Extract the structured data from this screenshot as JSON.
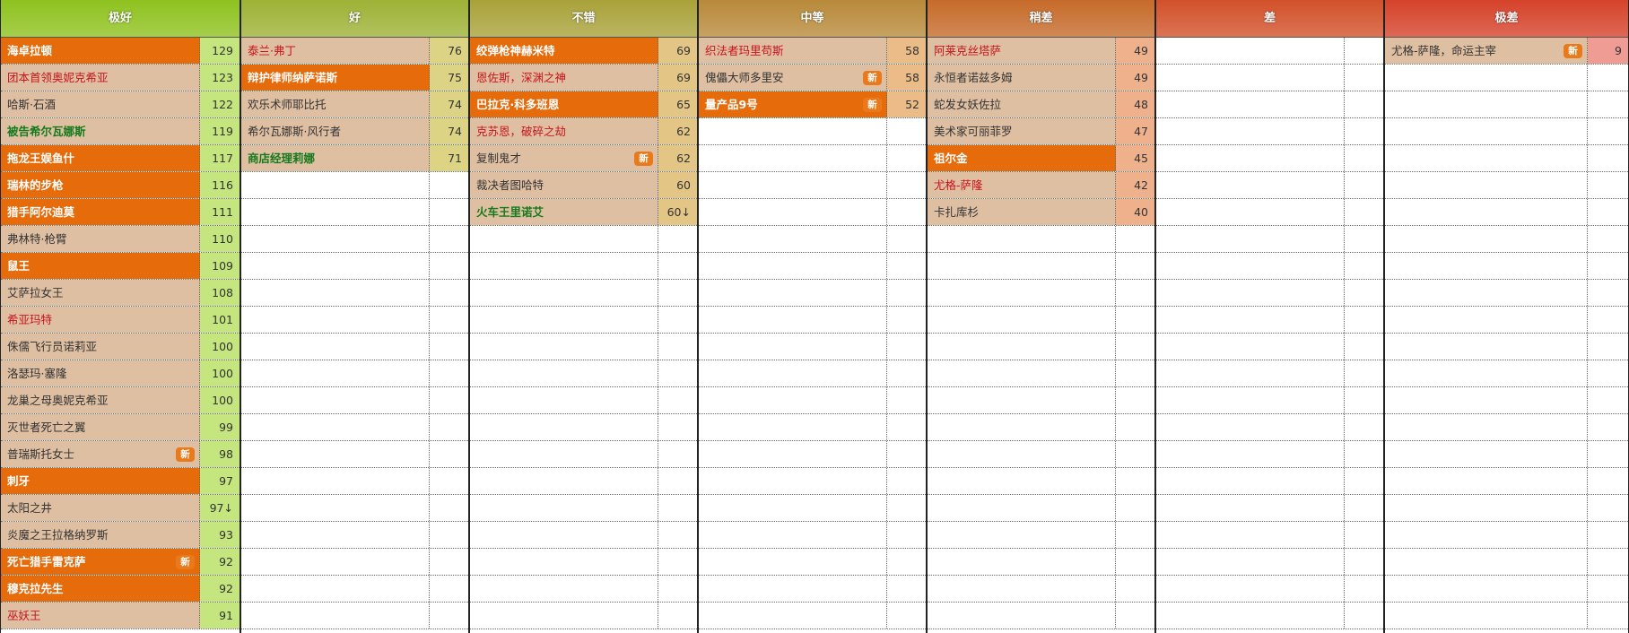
{
  "tier_list": {
    "columns": [
      {
        "key": "tier-best",
        "title": "极好",
        "header_color": "#8fc21f",
        "score_bg": "#c5e57e",
        "rows": [
          {
            "name": "海卓拉顿",
            "score": "129",
            "style": "orange",
            "new": false
          },
          {
            "name": "团本首领奥妮克希亚",
            "score": "123",
            "style": "red",
            "new": false
          },
          {
            "name": "哈斯·石酒",
            "score": "122",
            "style": "plain",
            "new": false
          },
          {
            "name": "被告希尔瓦娜斯",
            "score": "119",
            "style": "green",
            "new": false
          },
          {
            "name": "拖龙王娱鱼什",
            "score": "117",
            "style": "orange",
            "new": false
          },
          {
            "name": "瑞林的步枪",
            "score": "116",
            "style": "orange",
            "new": false
          },
          {
            "name": "猎手阿尔迪莫",
            "score": "111",
            "style": "orange",
            "new": false
          },
          {
            "name": "弗林特·枪臂",
            "score": "110",
            "style": "plain",
            "new": false
          },
          {
            "name": "鼠王",
            "score": "109",
            "style": "orange",
            "new": false
          },
          {
            "name": "艾萨拉女王",
            "score": "108",
            "style": "plain",
            "new": false
          },
          {
            "name": "希亚玛特",
            "score": "101",
            "style": "red",
            "new": false
          },
          {
            "name": "侏儒飞行员诺莉亚",
            "score": "100",
            "style": "plain",
            "new": false
          },
          {
            "name": "洛瑟玛·塞隆",
            "score": "100",
            "style": "plain",
            "new": false
          },
          {
            "name": "龙巢之母奥妮克希亚",
            "score": "100",
            "style": "plain",
            "new": false
          },
          {
            "name": "灭世者死亡之翼",
            "score": "99",
            "style": "plain",
            "new": false
          },
          {
            "name": "普瑞斯托女士",
            "score": "98",
            "style": "plain",
            "new": true
          },
          {
            "name": "刺牙",
            "score": "97",
            "style": "orange",
            "new": false
          },
          {
            "name": "太阳之井",
            "score": "97↓",
            "style": "plain",
            "new": false
          },
          {
            "name": "炎魔之王拉格纳罗斯",
            "score": "93",
            "style": "plain",
            "new": false
          },
          {
            "name": "死亡猎手雷克萨",
            "score": "92",
            "style": "orange",
            "new": true
          },
          {
            "name": "穆克拉先生",
            "score": "92",
            "style": "orange",
            "new": false
          },
          {
            "name": "巫妖王",
            "score": "91",
            "style": "red",
            "new": false
          }
        ]
      },
      {
        "key": "tier-good",
        "title": "好",
        "header_color": "#9db236",
        "score_bg": "#dcd384",
        "rows": [
          {
            "name": "泰兰·弗丁",
            "score": "76",
            "style": "red",
            "new": false
          },
          {
            "name": "辩护律师纳萨诺斯",
            "score": "75",
            "style": "orange",
            "new": false
          },
          {
            "name": "欢乐术师耶比托",
            "score": "74",
            "style": "plain",
            "new": false
          },
          {
            "name": "希尔瓦娜斯·风行者",
            "score": "74",
            "style": "plain",
            "new": false
          },
          {
            "name": "商店经理莉娜",
            "score": "71",
            "style": "green",
            "new": false
          }
        ]
      },
      {
        "key": "tier-fine",
        "title": "不错",
        "header_color": "#a9a23a",
        "score_bg": "#e3c585",
        "rows": [
          {
            "name": "绞弹枪神赫米特",
            "score": "69",
            "style": "orange",
            "new": false
          },
          {
            "name": "恩佐斯，深渊之神",
            "score": "69",
            "style": "red",
            "new": false
          },
          {
            "name": "巴拉克·科多班恩",
            "score": "65",
            "style": "orange",
            "new": false
          },
          {
            "name": "克苏恩，破碎之劫",
            "score": "62",
            "style": "red",
            "new": false
          },
          {
            "name": "复制鬼才",
            "score": "62",
            "style": "plain",
            "new": true
          },
          {
            "name": "裁决者图哈特",
            "score": "60",
            "style": "plain",
            "new": false
          },
          {
            "name": "火车王里诺艾",
            "score": "60↓",
            "style": "green",
            "new": false
          }
        ]
      },
      {
        "key": "tier-medium",
        "title": "中等",
        "header_color": "#b88a3a",
        "score_bg": "#ebbc88",
        "rows": [
          {
            "name": "织法者玛里苟斯",
            "score": "58",
            "style": "red",
            "new": false
          },
          {
            "name": "傀儡大师多里安",
            "score": "58",
            "style": "plain",
            "new": true
          },
          {
            "name": "量产品9号",
            "score": "52",
            "style": "orange",
            "new": true
          }
        ]
      },
      {
        "key": "tier-poor",
        "title": "稍差",
        "header_color": "#c66b2a",
        "score_bg": "#efb08c",
        "rows": [
          {
            "name": "阿莱克丝塔萨",
            "score": "49",
            "style": "red",
            "new": false
          },
          {
            "name": "永恒者诺兹多姆",
            "score": "49",
            "style": "plain",
            "new": false
          },
          {
            "name": "蛇发女妖佐拉",
            "score": "48",
            "style": "plain",
            "new": false
          },
          {
            "name": "美术家可丽菲罗",
            "score": "47",
            "style": "plain",
            "new": false
          },
          {
            "name": "祖尔金",
            "score": "45",
            "style": "orange",
            "new": false
          },
          {
            "name": "尤格-萨隆",
            "score": "42",
            "style": "red",
            "new": false
          },
          {
            "name": "卡扎库杉",
            "score": "40",
            "style": "plain",
            "new": false
          }
        ]
      },
      {
        "key": "tier-bad",
        "title": "差",
        "header_color": "#d2512a",
        "score_bg": "#f0a08c",
        "rows": []
      },
      {
        "key": "tier-worst",
        "title": "极差",
        "header_color": "#d6422a",
        "score_bg": "#ee9c94",
        "rows": [
          {
            "name": "尤格-萨隆，命运主宰",
            "score": "9",
            "style": "plain",
            "new": true
          }
        ]
      }
    ],
    "new_badge_label": "新",
    "colors": {
      "orange_row": "#e56b0b",
      "name_cell": "#dfbfa2",
      "red_text": "#c8141e",
      "green_text": "#157a1d",
      "badge": "#e87a1c"
    }
  }
}
